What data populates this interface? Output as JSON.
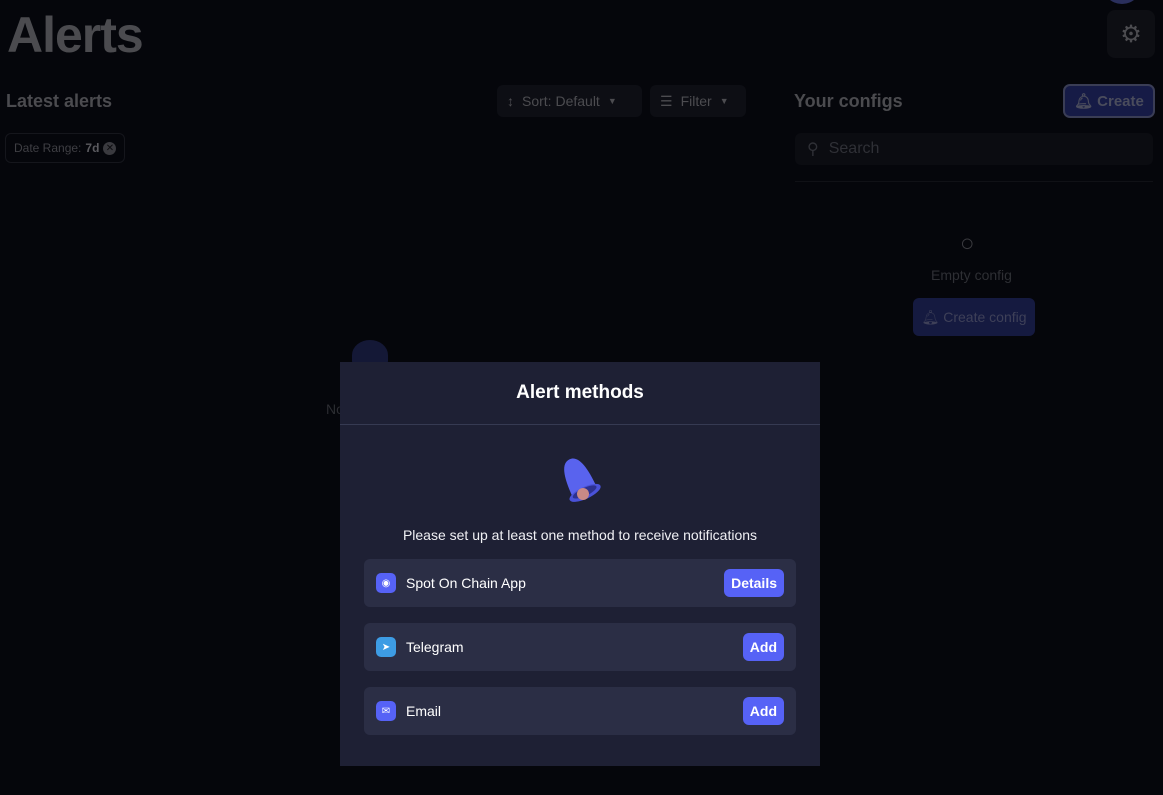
{
  "page": {
    "title": "Alerts"
  },
  "latest": {
    "heading": "Latest alerts",
    "sort_label": "Sort: Default",
    "filter_label": "Filter",
    "chip_label": "Date Range:",
    "chip_value": "7d",
    "empty_text": "No"
  },
  "configs": {
    "heading": "Your configs",
    "create_label": "Create",
    "search_placeholder": "Search",
    "empty_text": "Empty config",
    "create_config_label": "Create config"
  },
  "modal": {
    "title": "Alert methods",
    "description": "Please set up at least one method to receive notifications",
    "methods": [
      {
        "label": "Spot On Chain App",
        "action": "Details",
        "icon": "spot-on-chain-icon"
      },
      {
        "label": "Telegram",
        "action": "Add",
        "icon": "telegram-icon"
      },
      {
        "label": "Email",
        "action": "Add",
        "icon": "email-icon"
      }
    ]
  },
  "colors": {
    "accent": "#5662f6",
    "modal_bg": "#1e2034",
    "row_bg": "#2b2e45",
    "page_bg": "#05060b"
  }
}
